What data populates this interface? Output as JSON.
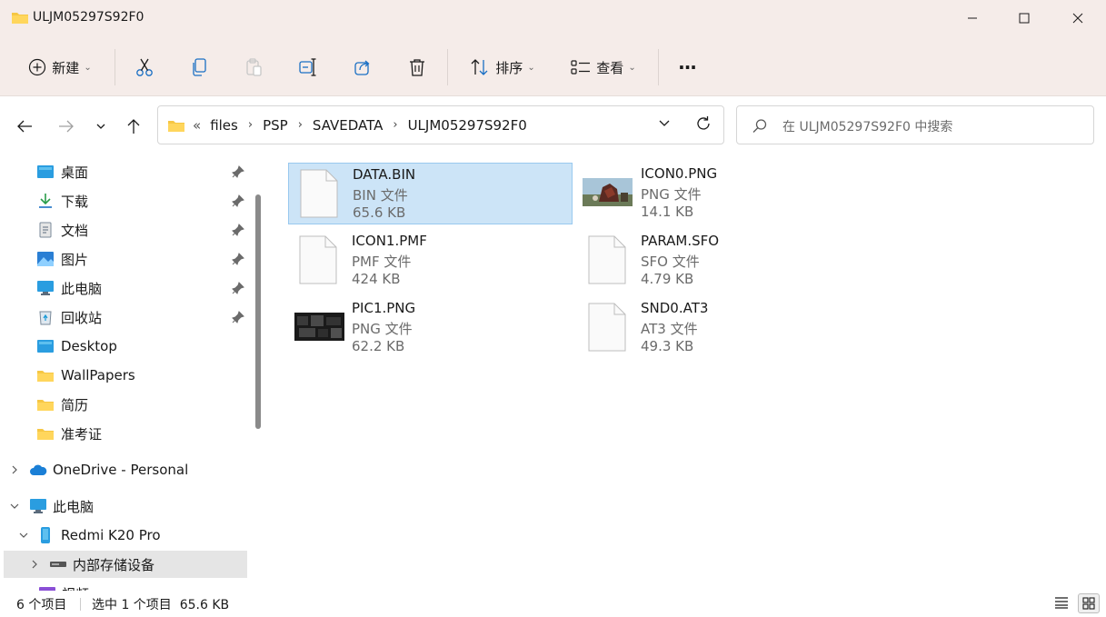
{
  "window": {
    "title": "ULJM05297S92F0",
    "minimize_icon": "minimize-icon",
    "maximize_icon": "maximize-icon",
    "close_icon": "close-icon"
  },
  "toolbar": {
    "new_label": "新建",
    "sort_label": "排序",
    "view_label": "查看",
    "more_label": "···"
  },
  "breadcrumb": {
    "overflow": "«",
    "items": [
      "files",
      "PSP",
      "SAVEDATA",
      "ULJM05297S92F0"
    ]
  },
  "search": {
    "placeholder": "在 ULJM05297S92F0 中搜索"
  },
  "sidebar": {
    "quick_access": [
      {
        "label": "桌面",
        "icon": "desktop-icon",
        "pinned": true
      },
      {
        "label": "下载",
        "icon": "download-icon",
        "pinned": true
      },
      {
        "label": "文档",
        "icon": "documents-icon",
        "pinned": true
      },
      {
        "label": "图片",
        "icon": "pictures-icon",
        "pinned": true
      },
      {
        "label": "此电脑",
        "icon": "this-pc-icon",
        "pinned": true
      },
      {
        "label": "回收站",
        "icon": "recycle-bin-icon",
        "pinned": true
      },
      {
        "label": "Desktop",
        "icon": "folder-icon",
        "pinned": false
      },
      {
        "label": "WallPapers",
        "icon": "folder-icon",
        "pinned": false
      },
      {
        "label": "简历",
        "icon": "folder-icon",
        "pinned": false
      },
      {
        "label": "准考证",
        "icon": "folder-icon",
        "pinned": false
      }
    ],
    "onedrive": "OneDrive - Personal",
    "this_pc": "此电脑",
    "device": "Redmi K20 Pro",
    "storage": "内部存储设备",
    "partial": "视频"
  },
  "files": [
    {
      "name": "DATA.BIN",
      "type": "BIN 文件",
      "size": "65.6 KB",
      "icon": "blank-file-icon",
      "selected": true
    },
    {
      "name": "ICON0.PNG",
      "type": "PNG 文件",
      "size": "14.1 KB",
      "icon": "image-thumbnail-icon",
      "selected": false
    },
    {
      "name": "ICON1.PMF",
      "type": "PMF 文件",
      "size": "424 KB",
      "icon": "blank-file-icon",
      "selected": false
    },
    {
      "name": "PARAM.SFO",
      "type": "SFO 文件",
      "size": "4.79 KB",
      "icon": "blank-file-icon",
      "selected": false
    },
    {
      "name": "PIC1.PNG",
      "type": "PNG 文件",
      "size": "62.2 KB",
      "icon": "image-thumbnail-icon",
      "selected": false
    },
    {
      "name": "SND0.AT3",
      "type": "AT3 文件",
      "size": "49.3 KB",
      "icon": "blank-file-icon",
      "selected": false
    }
  ],
  "status": {
    "count": "6 个项目",
    "selection": "选中 1 个项目  65.6 KB"
  },
  "colors": {
    "title_bg": "#f5ece9",
    "selection_bg": "#cce4f7",
    "selection_border": "#99c9ef",
    "accent": "#0067c0",
    "folder": "#f6c744"
  }
}
